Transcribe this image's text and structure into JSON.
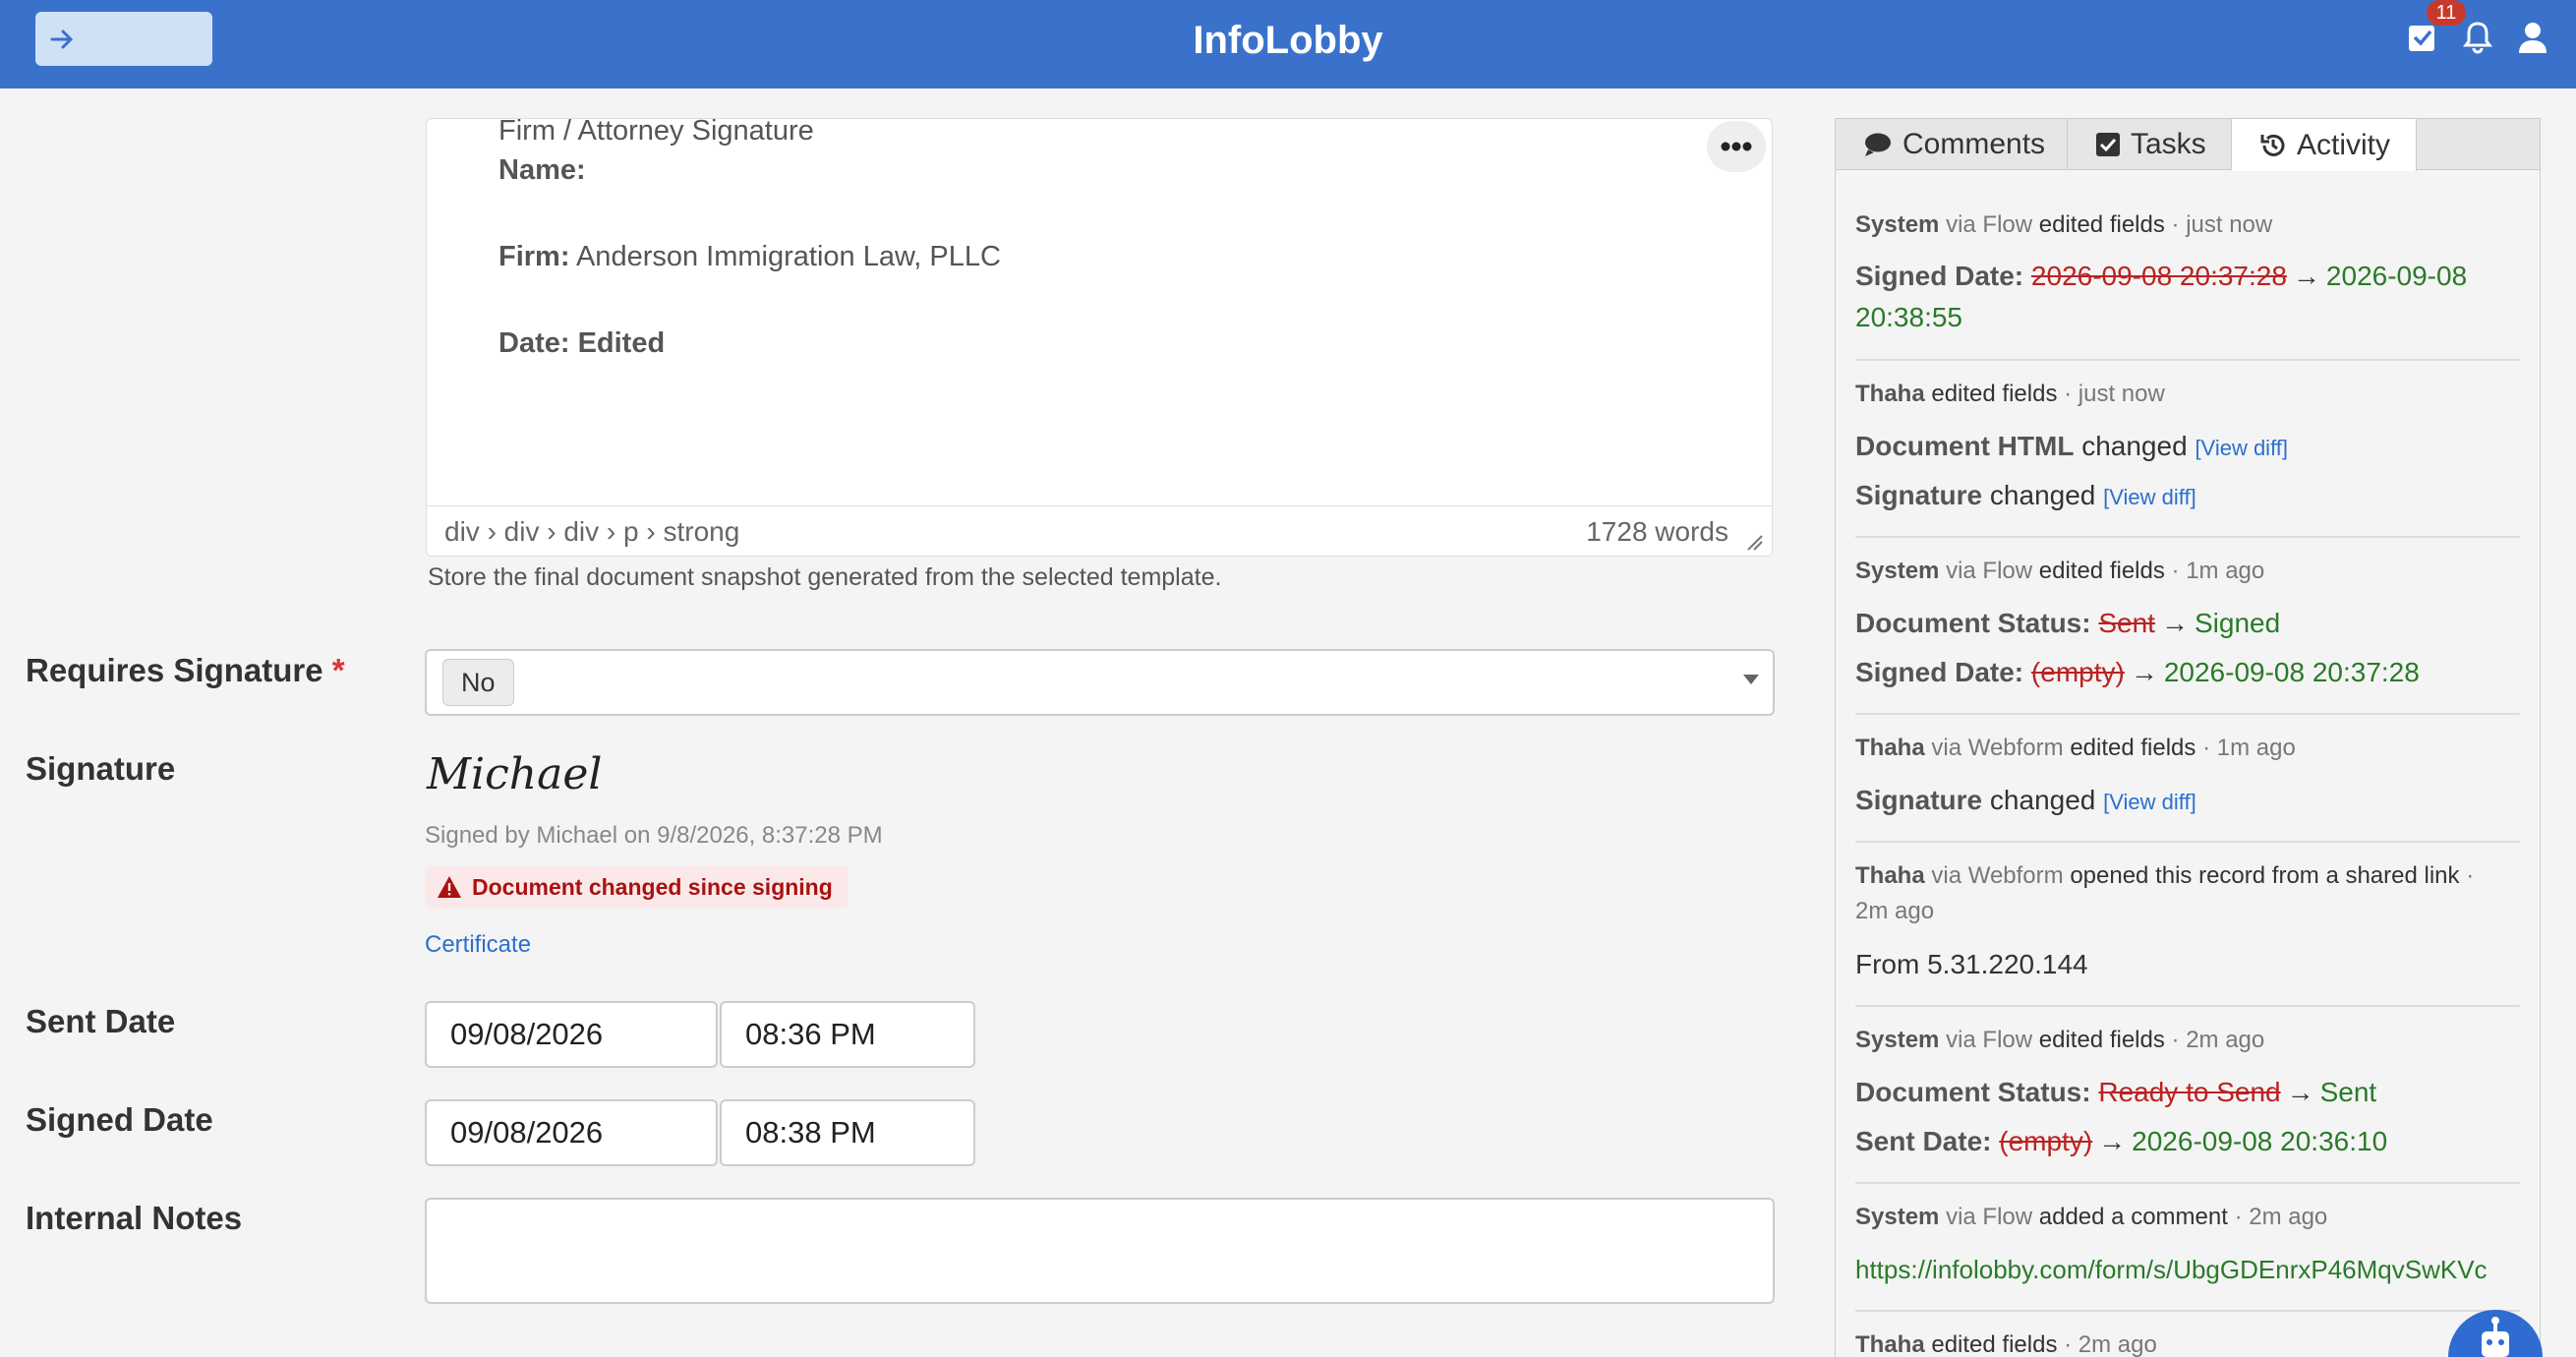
{
  "header": {
    "title": "InfoLobby",
    "task_badge_count": "11"
  },
  "editor": {
    "heading": "Firm / Attorney Signature",
    "name_label": "Name:",
    "firm_label": "Firm:",
    "firm_value": "Anderson Immigration Law, PLLC",
    "date_label": "Date: Edited",
    "element_path": "div › div › div › p › strong",
    "word_count": "1728 words",
    "help_text": "Store the final document snapshot generated from the selected template."
  },
  "fields": {
    "requires_signature": {
      "label": "Requires Signature",
      "required_mark": "*",
      "value": "No"
    },
    "signature": {
      "label": "Signature",
      "script_text": "Michael",
      "signed_by": "Signed by Michael on 9/8/2026, 8:37:28 PM",
      "warning": "Document changed since signing",
      "certificate_link": "Certificate"
    },
    "sent_date": {
      "label": "Sent Date",
      "date": "09/08/2026",
      "time": "08:36 PM"
    },
    "signed_date": {
      "label": "Signed Date",
      "date": "09/08/2026",
      "time": "08:38 PM"
    },
    "internal_notes": {
      "label": "Internal Notes",
      "value": ""
    }
  },
  "panel": {
    "tabs": [
      {
        "label": "Comments",
        "icon": "comment-icon",
        "active": false
      },
      {
        "label": "Tasks",
        "icon": "checkbox-icon",
        "active": false
      },
      {
        "label": "Activity",
        "icon": "history-icon",
        "active": true
      }
    ],
    "activity": [
      {
        "who": "System",
        "via": "via",
        "source": "Flow",
        "action": "edited fields",
        "time": "· just now",
        "changes": [
          {
            "field": "Signed Date:",
            "old": "2026-09-08 20:37:28",
            "new": "2026-09-08",
            "new_cont": "20:38:55"
          }
        ]
      },
      {
        "who": "Thaha",
        "action": "edited fields",
        "time": "· just now",
        "changes": [
          {
            "field": "Document HTML",
            "text": "changed",
            "link": "[View diff]"
          },
          {
            "field": "Signature",
            "text": "changed",
            "link": "[View diff]"
          }
        ]
      },
      {
        "who": "System",
        "via": "via",
        "source": "Flow",
        "action": "edited fields",
        "time": "· 1m ago",
        "changes": [
          {
            "field": "Document Status:",
            "old": "Sent",
            "new": "Signed"
          },
          {
            "field": "Signed Date:",
            "old": "(empty)",
            "new": "2026-09-08 20:37:28"
          }
        ]
      },
      {
        "who": "Thaha",
        "via": "via",
        "source": "Webform",
        "action": "edited fields",
        "time": "· 1m ago",
        "changes": [
          {
            "field": "Signature",
            "text": "changed",
            "link": "[View diff]"
          }
        ]
      },
      {
        "who": "Thaha",
        "via": "via",
        "source": "Webform",
        "action": "opened this record from a shared link",
        "time": "·",
        "time2": "2m ago",
        "detail": "From 5.31.220.144"
      },
      {
        "who": "System",
        "via": "via",
        "source": "Flow",
        "action": "edited fields",
        "time": "· 2m ago",
        "changes": [
          {
            "field": "Document Status:",
            "old": "Ready to Send",
            "new": "Sent"
          },
          {
            "field": "Sent Date:",
            "old": "(empty)",
            "new": "2026-09-08 20:36:10"
          }
        ]
      },
      {
        "who": "System",
        "via": "via",
        "source": "Flow",
        "action": "added a comment",
        "time": "· 2m ago",
        "url": "https://infolobby.com/form/s/UbgGDEnrxP46MqvSwKVc"
      },
      {
        "who": "Thaha",
        "action": "edited fields",
        "time": "· 2m ago"
      }
    ]
  },
  "colors": {
    "header": "#3a72cb",
    "old_value": "#b22222",
    "new_value": "#2a7a2a",
    "link": "#2a6fcf"
  }
}
